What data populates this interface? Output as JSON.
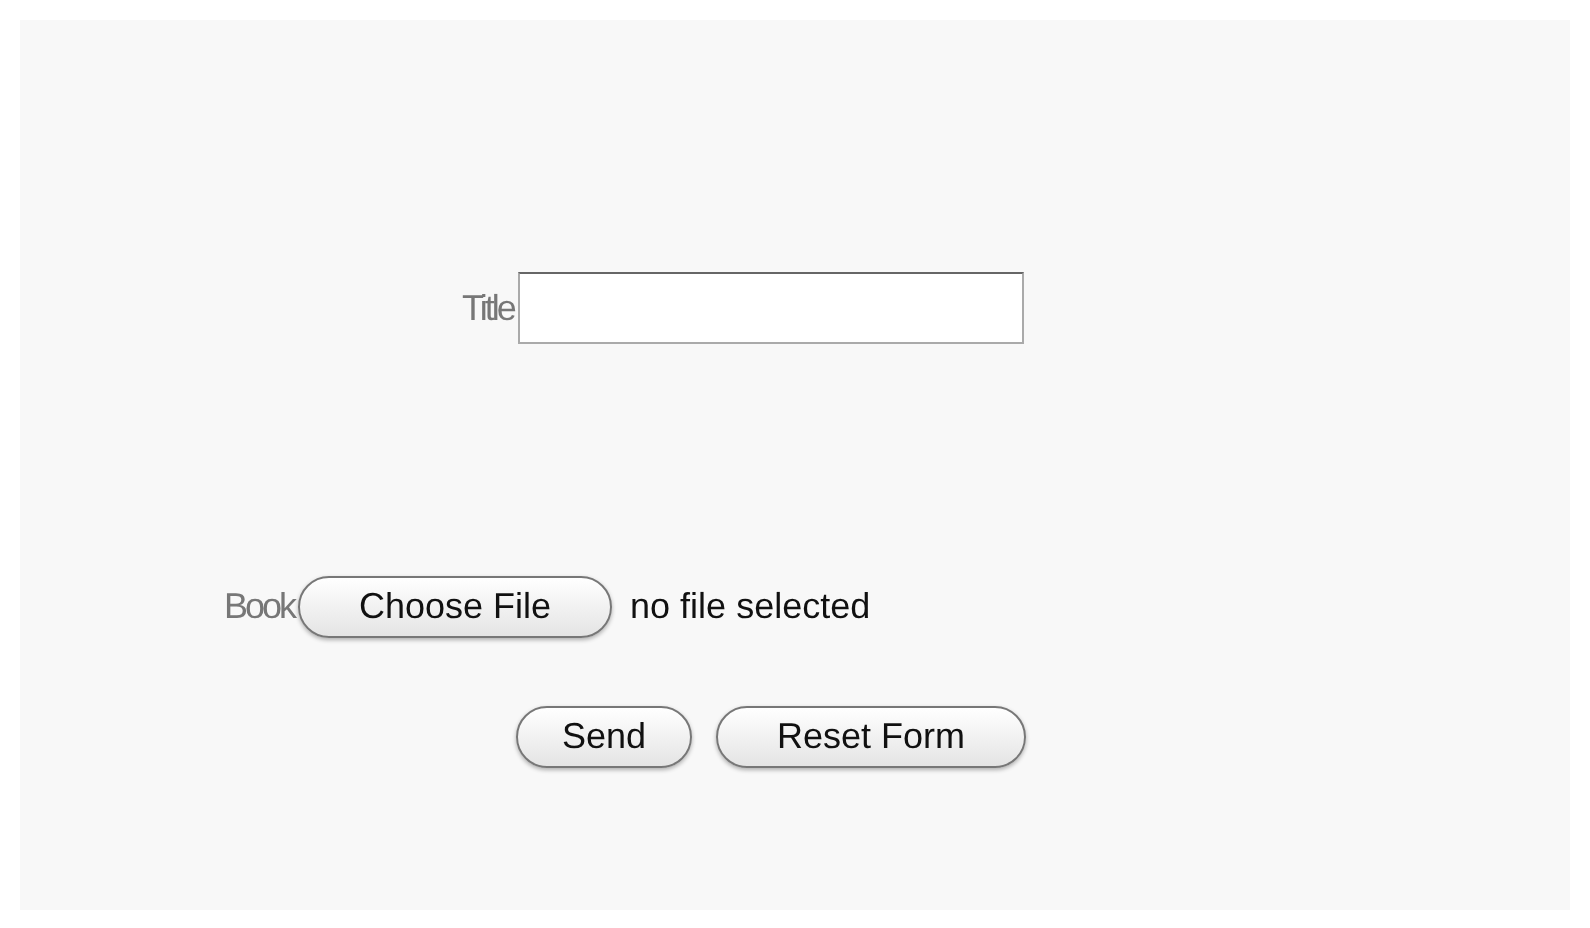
{
  "title_field": {
    "label": "Title"
  },
  "book_field": {
    "label": "Book",
    "button": "Choose File",
    "status": "no file selected"
  },
  "buttons": [
    "Send",
    "Reset Form"
  ]
}
